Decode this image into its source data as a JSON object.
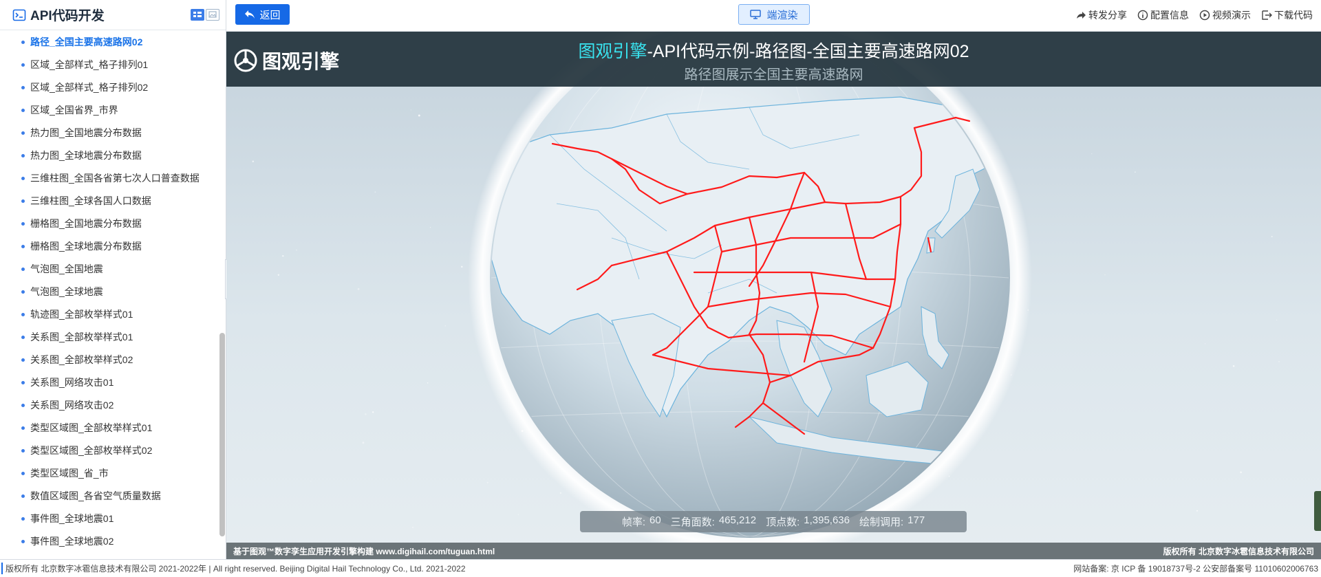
{
  "sidebar": {
    "title": "API代码开发",
    "title_icon": "terminal-icon",
    "items": [
      {
        "label": "路径_全国主要高速路网02",
        "active": true
      },
      {
        "label": "区域_全部样式_格子排列01"
      },
      {
        "label": "区域_全部样式_格子排列02"
      },
      {
        "label": "区域_全国省界_市界"
      },
      {
        "label": "热力图_全国地震分布数据"
      },
      {
        "label": "热力图_全球地震分布数据"
      },
      {
        "label": "三维柱图_全国各省第七次人口普查数据"
      },
      {
        "label": "三维柱图_全球各国人口数据"
      },
      {
        "label": "栅格图_全国地震分布数据"
      },
      {
        "label": "栅格图_全球地震分布数据"
      },
      {
        "label": "气泡图_全国地震"
      },
      {
        "label": "气泡图_全球地震"
      },
      {
        "label": "轨迹图_全部枚举样式01"
      },
      {
        "label": "关系图_全部枚举样式01"
      },
      {
        "label": "关系图_全部枚举样式02"
      },
      {
        "label": "关系图_网络攻击01"
      },
      {
        "label": "关系图_网络攻击02"
      },
      {
        "label": "类型区域图_全部枚举样式01"
      },
      {
        "label": "类型区域图_全部枚举样式02"
      },
      {
        "label": "类型区域图_省_市"
      },
      {
        "label": "数值区域图_各省空气质量数据"
      },
      {
        "label": "事件图_全球地震01"
      },
      {
        "label": "事件图_全球地震02"
      }
    ]
  },
  "toolbar": {
    "back_label": "返回",
    "render_label": "端渲染",
    "actions": [
      {
        "label": "转发分享",
        "icon": "share-icon"
      },
      {
        "label": "配置信息",
        "icon": "info-icon"
      },
      {
        "label": "视频演示",
        "icon": "play-icon"
      },
      {
        "label": "下载代码",
        "icon": "download-icon"
      }
    ]
  },
  "viewport": {
    "logo_text": "图观引擎",
    "title_highlight": "图观引擎",
    "title_rest": "-API代码示例-路径图-全国主要高速路网02",
    "subtitle": "路径图展示全国主要高速路网",
    "stats": [
      {
        "label": "帧率:",
        "value": "60"
      },
      {
        "label": "三角面数:",
        "value": "465,212"
      },
      {
        "label": "顶点数:",
        "value": "1,395,636"
      },
      {
        "label": "绘制调用:",
        "value": "177"
      }
    ],
    "credit_left": "基于图观™数字孪生应用开发引擎构建 www.digihail.com/tuguan.html",
    "credit_right": "版权所有 北京数字冰雹信息技术有限公司"
  },
  "footer": {
    "left": "版权所有 北京数字冰雹信息技术有限公司 2021-2022年 | All right reserved. Beijing Digital Hail Technology Co., Ltd. 2021-2022",
    "right": "网站备案: 京 ICP 备 19018737号-2 公安部备案号 11010602006763"
  },
  "colors": {
    "accent": "#1669e6",
    "route": "#ff1a1a",
    "banner_highlight": "#39e4f0"
  }
}
